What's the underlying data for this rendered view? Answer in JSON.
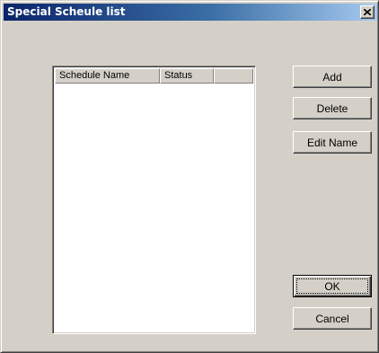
{
  "window": {
    "title": "Special Scheule list",
    "close_icon": "close-icon"
  },
  "list": {
    "columns": [
      "Schedule Name",
      "Status",
      ""
    ],
    "rows": []
  },
  "buttons": {
    "add": "Add",
    "delete": "Delete",
    "edit_name": "Edit Name",
    "ok": "OK",
    "cancel": "Cancel"
  }
}
